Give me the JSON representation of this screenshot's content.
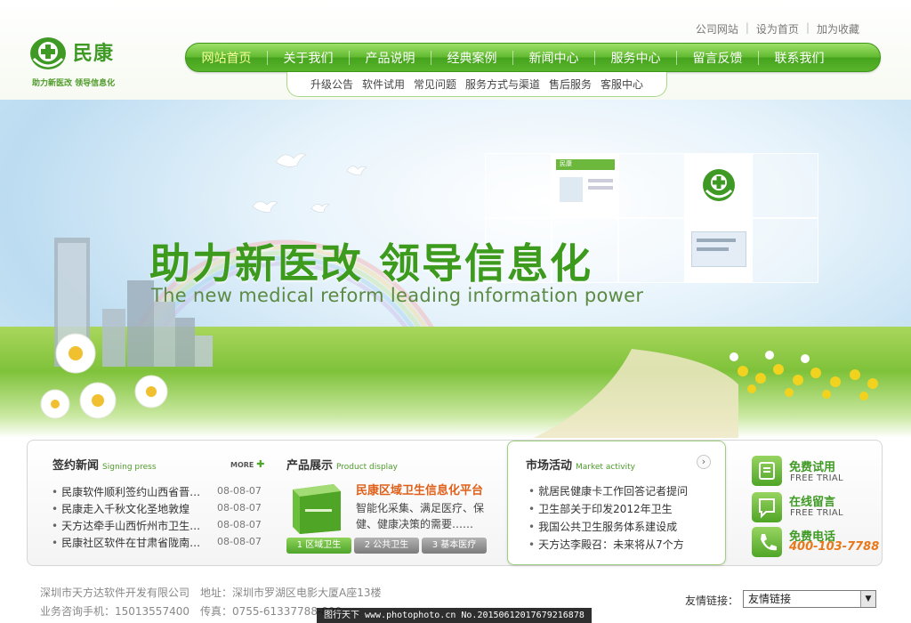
{
  "brand": {
    "name": "民康",
    "slogan": "助力新医改 领导信息化",
    "primary_color": "#4ea52a",
    "accent_color": "#e0601a"
  },
  "top_links": [
    "公司网站",
    "设为首页",
    "加为收藏"
  ],
  "main_nav": {
    "active_index": 0,
    "items": [
      "网站首页",
      "关于我们",
      "产品说明",
      "经典案例",
      "新闻中心",
      "服务中心",
      "留言反馈",
      "联系我们"
    ]
  },
  "sub_nav": [
    "升级公告",
    "软件试用",
    "常见问题",
    "服务方式与渠道",
    "售后服务",
    "客服中心"
  ],
  "banner": {
    "headline": "助力新医改  领导信息化",
    "subline": "The new medical reform leading information power",
    "thumb_label": "民康"
  },
  "signing_news": {
    "title": "签约新闻",
    "title_en": "Signing press",
    "more": "MORE",
    "items": [
      {
        "text": "民康软件顺利签约山西省晋…",
        "date": "08-08-07"
      },
      {
        "text": "民康走入千秋文化圣地敦煌",
        "date": "08-08-07"
      },
      {
        "text": "天方达牵手山西忻州市卫生…",
        "date": "08-08-07"
      },
      {
        "text": "民康社区软件在甘肃省陇南…",
        "date": "08-08-07"
      }
    ]
  },
  "product_display": {
    "title": "产品展示",
    "title_en": "Product display",
    "product_title": "民康区域卫生信息化平台",
    "product_desc": "智能化采集、满足医疗、保健、健康决策的需要……",
    "tabs": [
      "1 区域卫生",
      "2 公共卫生",
      "3 基本医疗"
    ],
    "active_tab": 0
  },
  "market_activity": {
    "title": "市场活动",
    "title_en": "Market activity",
    "items": [
      "就居民健康卡工作回答记者提问",
      "卫生部关于印发2012年卫生",
      "我国公共卫生服务体系建设成",
      "天方达李殿召：未来将从7个方"
    ]
  },
  "side_actions": [
    {
      "cn": "免费试用",
      "en": "FREE TRIAL",
      "icon": "trial-icon"
    },
    {
      "cn": "在线留言",
      "en": "FREE TRIAL",
      "icon": "message-icon"
    },
    {
      "cn": "免费电话",
      "phone": "400-103-7788",
      "icon": "phone-icon"
    }
  ],
  "footer": {
    "company": "深圳市天方达软件开发有限公司",
    "address": "地址：深圳市罗湖区电影大厦A座13楼",
    "mobile": "业务咨询手机：15013557400",
    "fax": "传真：0755-61337788-800",
    "links_label": "友情链接：",
    "links_selected": "友情链接"
  },
  "watermark": "图行天下 www.photophoto.cn  No.20150612017679216878"
}
